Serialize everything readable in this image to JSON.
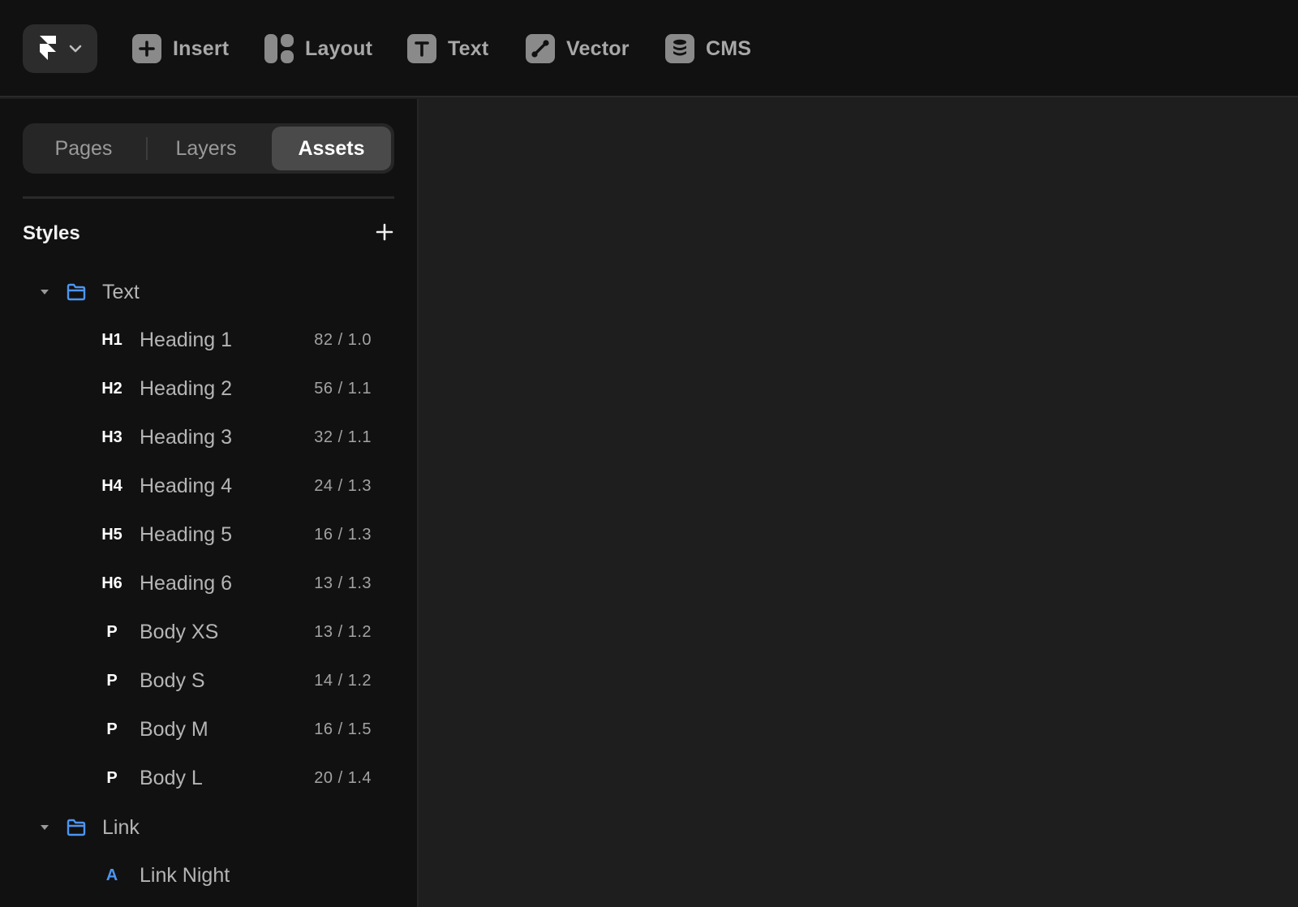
{
  "toolbar": {
    "tools": [
      {
        "id": "insert",
        "label": "Insert",
        "icon": "plus-icon"
      },
      {
        "id": "layout",
        "label": "Layout",
        "icon": "layout-icon"
      },
      {
        "id": "text",
        "label": "Text",
        "icon": "text-t-icon"
      },
      {
        "id": "vector",
        "label": "Vector",
        "icon": "pen-vector-icon"
      },
      {
        "id": "cms",
        "label": "CMS",
        "icon": "database-icon"
      }
    ]
  },
  "panel": {
    "tabs": [
      {
        "label": "Pages",
        "active": false
      },
      {
        "label": "Layers",
        "active": false
      },
      {
        "label": "Assets",
        "active": true
      }
    ],
    "section_title": "Styles",
    "groups": [
      {
        "name": "Text",
        "items": [
          {
            "tag": "H1",
            "name": "Heading 1",
            "meta": "82 / 1.0"
          },
          {
            "tag": "H2",
            "name": "Heading 2",
            "meta": "56 / 1.1"
          },
          {
            "tag": "H3",
            "name": "Heading 3",
            "meta": "32 / 1.1"
          },
          {
            "tag": "H4",
            "name": "Heading 4",
            "meta": "24 / 1.3"
          },
          {
            "tag": "H5",
            "name": "Heading 5",
            "meta": "16 / 1.3"
          },
          {
            "tag": "H6",
            "name": "Heading 6",
            "meta": "13 / 1.3"
          },
          {
            "tag": "P",
            "name": "Body XS",
            "meta": "13 / 1.2"
          },
          {
            "tag": "P",
            "name": "Body S",
            "meta": "14 / 1.2"
          },
          {
            "tag": "P",
            "name": "Body M",
            "meta": "16 / 1.5"
          },
          {
            "tag": "P",
            "name": "Body L",
            "meta": "20 / 1.4"
          }
        ]
      },
      {
        "name": "Link",
        "items": [
          {
            "tag": "A",
            "name": "Link Night",
            "meta": ""
          }
        ]
      }
    ]
  },
  "colors": {
    "accent_blue": "#4d95f0",
    "panel_bg": "#111111",
    "canvas_bg": "#1e1e1e"
  }
}
